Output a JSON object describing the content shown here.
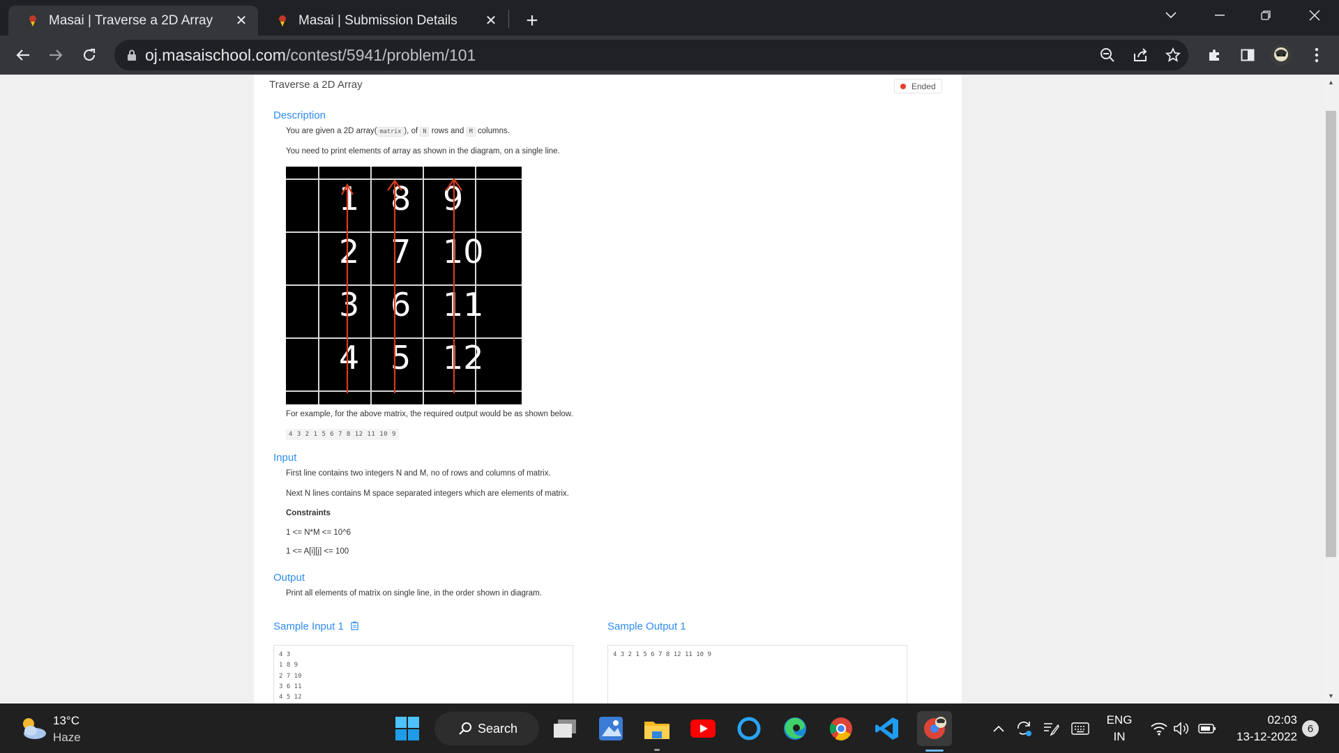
{
  "browser": {
    "tabs": [
      {
        "title": "Masai | Traverse a 2D Array",
        "active": true
      },
      {
        "title": "Masai | Submission Details",
        "active": false
      }
    ],
    "url_host": "oj.masaischool.com",
    "url_path": "/contest/5941/problem/101"
  },
  "problem": {
    "title": "Traverse a 2D Array",
    "status": "Ended",
    "status_color": "#ea3b2a",
    "description_heading": "Description",
    "desc_line1_prefix": "You are given a 2D array(",
    "desc_code_matrix": "matrix",
    "desc_line1_mid": "), of",
    "desc_code_n": "N",
    "desc_line1_mid2": "rows and",
    "desc_code_m": "M",
    "desc_line1_suffix": "columns.",
    "desc_line2": "You need to print elements of array as shown in the diagram, on a single line.",
    "diagram_grid": [
      [
        "1",
        "8",
        "9"
      ],
      [
        "2",
        "7",
        "10"
      ],
      [
        "3",
        "6",
        "11"
      ],
      [
        "4",
        "5",
        "12"
      ]
    ],
    "example_text": "For example, for the above matrix, the required output would be as shown below.",
    "example_output": "4 3 2 1 5 6 7 8 12 11 10 9",
    "input_heading": "Input",
    "input_line1": "First line contains two integers N and M, no of rows and columns of matrix.",
    "input_line2": "Next N lines contains M space separated integers which are elements of matrix.",
    "constraints_label": "Constraints",
    "constraint1": "1 <= N*M <= 10^6",
    "constraint2": "1 <= A[i][j] <= 100",
    "output_heading": "Output",
    "output_line": "Print all elements of matrix on single line, in the order shown in diagram.",
    "sample_input_heading": "Sample Input 1",
    "sample_output_heading": "Sample Output 1",
    "sample_input": "4 3\n1 8 9\n2 7 10\n3 6 11\n4 5 12",
    "sample_output": "4 3 2 1 5 6 7 8 12 11 10 9"
  },
  "taskbar": {
    "weather_temp": "13°C",
    "weather_desc": "Haze",
    "search_label": "Search",
    "lang_top": "ENG",
    "lang_bottom": "IN",
    "time": "02:03",
    "date": "13-12-2022",
    "notification_count": "6"
  }
}
